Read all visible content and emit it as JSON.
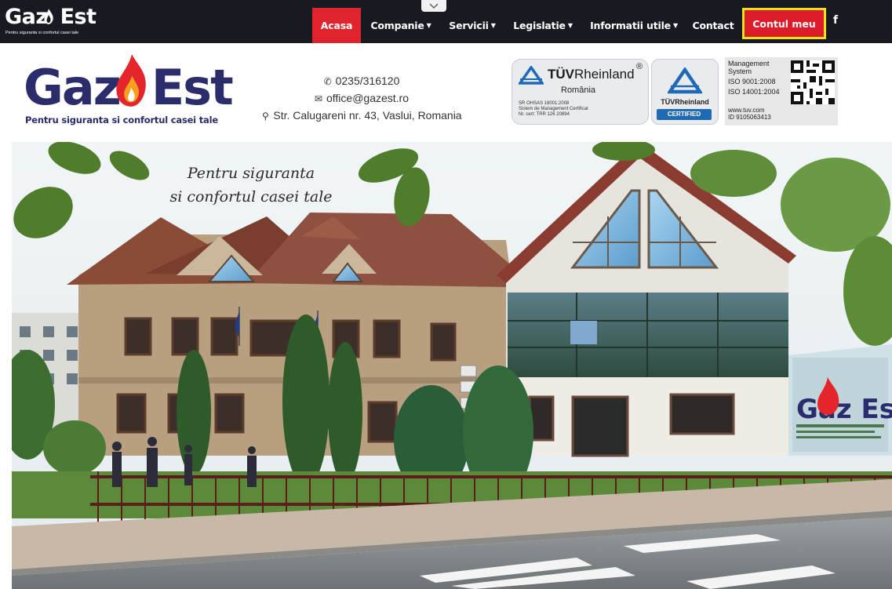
{
  "navbar": {
    "logo_text": "Gaz Est",
    "logo_tagline": "Pentru siguranta si confortul casei tale",
    "menu": [
      {
        "label": "Acasa",
        "active": true,
        "dropdown": false
      },
      {
        "label": "Companie",
        "active": false,
        "dropdown": true
      },
      {
        "label": "Servicii",
        "active": false,
        "dropdown": true
      },
      {
        "label": "Legislatie",
        "active": false,
        "dropdown": true
      },
      {
        "label": "Informatii utile",
        "active": false,
        "dropdown": true
      },
      {
        "label": "Contact",
        "active": false,
        "dropdown": false
      }
    ],
    "account_label": "Contul meu",
    "facebook_label": "f",
    "toggle_icon": "chevron-down-icon"
  },
  "header": {
    "brand_text": "Gaz Est",
    "brand_tagline": "Pentru siguranta si confortul casei tale",
    "phone": "0235/316120",
    "email": "office@gazest.ro",
    "address": "Str. Calugareni nr. 43, Vaslui, Romania",
    "cert_tuv": {
      "brand_bold": "TÜV",
      "brand_rest": "Rheinland",
      "reg_mark": "®",
      "country": "România",
      "line1": "SR OHSAS 18001:2008",
      "line2": "Sistem de Management Certificat",
      "line3": "Nr. cert: TRR 126 20894"
    },
    "cert_badge": {
      "name": "TÜVRheinland",
      "status": "CERTIFIED"
    },
    "cert_ms": {
      "line1": "Management",
      "line2": "System",
      "line3": "ISO 9001:2008",
      "line4": "ISO 14001:2004",
      "line5": "www.tuv.com",
      "line6": "ID 9105063413"
    }
  },
  "hero": {
    "caption_line1": "Pentru siguranta",
    "caption_line2": "si confortul casei tale",
    "billboard_text": "Gaz Est"
  },
  "colors": {
    "navbar_bg": "#171a21",
    "active_red": "#e0242e",
    "account_border": "#f2e21a",
    "brand_navy": "#2b2c6b",
    "flame_red": "#e4262c",
    "flame_orange": "#f6a01f"
  }
}
